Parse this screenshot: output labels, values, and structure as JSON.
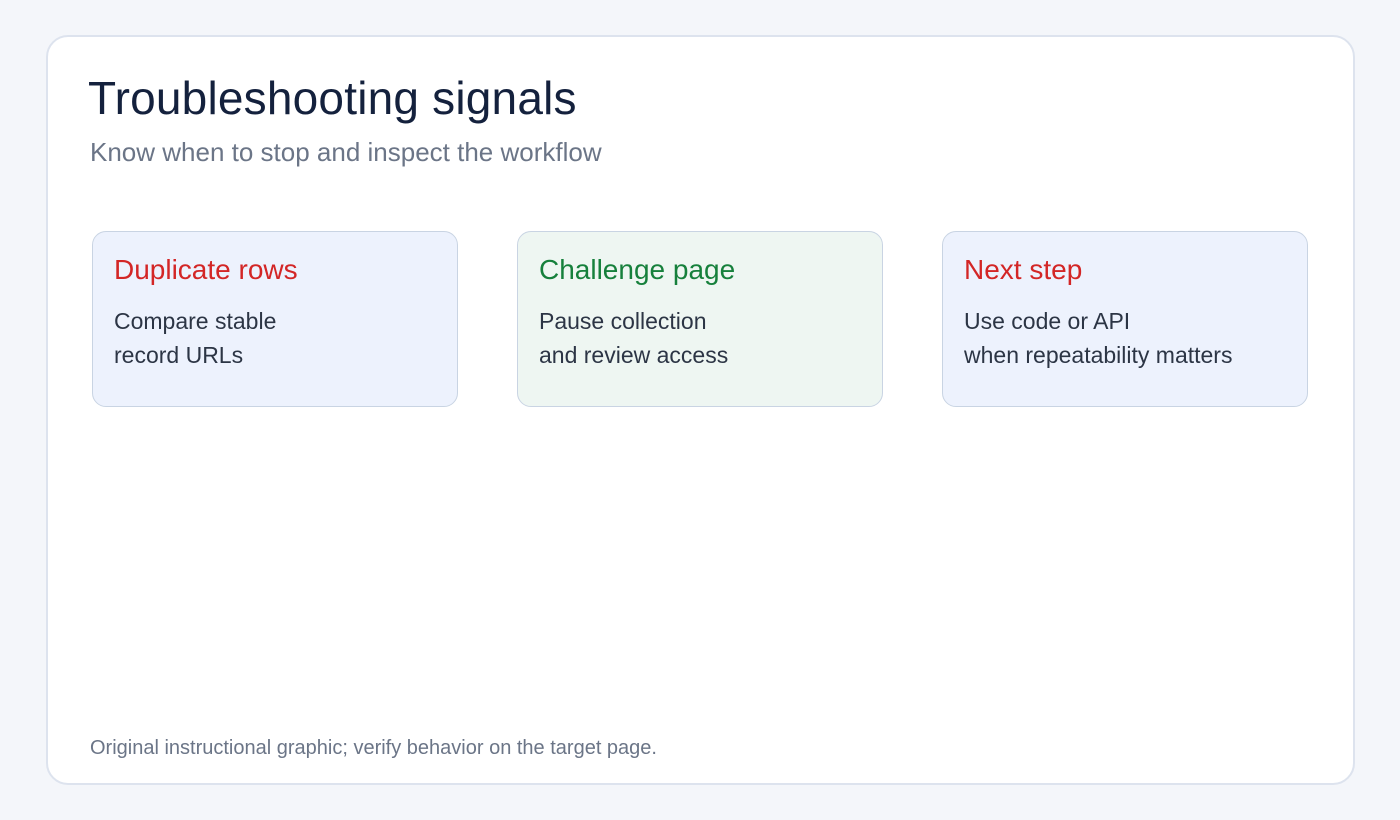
{
  "header": {
    "title": "Troubleshooting signals",
    "subtitle": "Know when to stop and inspect the workflow"
  },
  "cards": [
    {
      "title": "Duplicate rows",
      "title_color": "#d32626",
      "lines": [
        "Compare stable",
        "record URLs"
      ]
    },
    {
      "title": "Challenge page",
      "title_color": "#16803c",
      "lines": [
        "Pause collection",
        "and review access"
      ]
    },
    {
      "title": "Next step",
      "title_color": "#d32626",
      "lines": [
        "Use code or API",
        "when repeatability matters"
      ]
    }
  ],
  "footer": {
    "note": "Original instructional graphic; verify behavior on the target page."
  }
}
